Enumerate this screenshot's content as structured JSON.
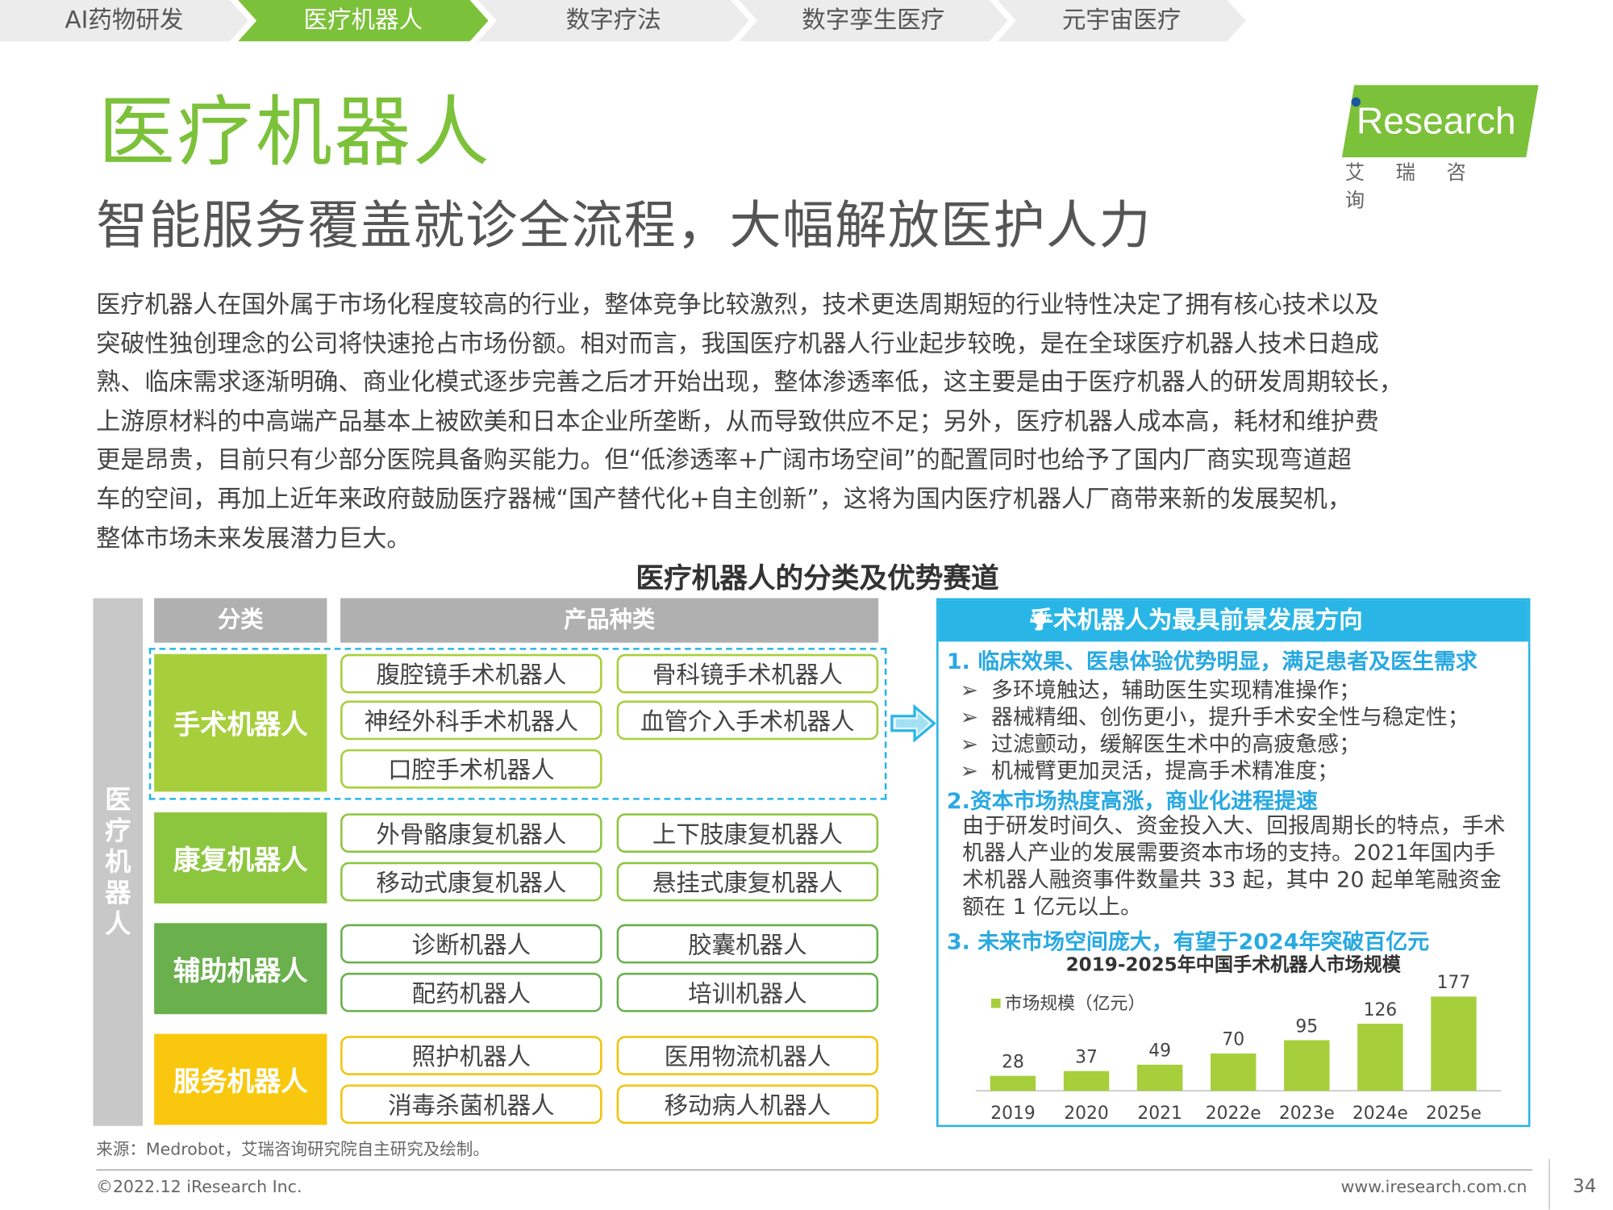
{
  "tabs": [
    {
      "label": "AI药物研发",
      "active": false
    },
    {
      "label": "医疗机器人",
      "active": true
    },
    {
      "label": "数字疗法",
      "active": false
    },
    {
      "label": "数字孪生医疗",
      "active": false
    },
    {
      "label": "元宇宙医疗",
      "active": false
    }
  ],
  "header": {
    "title": "医疗机器人",
    "subtitle": "智能服务覆盖就诊全流程，大幅解放医护人力"
  },
  "logo": {
    "text": "Research",
    "cn": "艾瑞咨询"
  },
  "body_text": "医疗机器人在国外属于市场化程度较高的行业，整体竞争比较激烈，技术更迭周期短的行业特性决定了拥有核心技术以及\n突破性独创理念的公司将快速抢占市场份额。相对而言，我国医疗机器人行业起步较晚，是在全球医疗机器人技术日趋成\n熟、临床需求逐渐明确、商业化模式逐步完善之后才开始出现，整体渗透率低，这主要是由于医疗机器人的研发周期较长，\n上游原材料的中高端产品基本上被欧美和日本企业所垄断，从而导致供应不足；另外，医疗机器人成本高，耗材和维护费\n更是昂贵，目前只有少部分医院具备购买能力。但“低渗透率+广阔市场空间”的配置同时也给予了国内厂商实现弯道超\n车的空间，再加上近年来政府鼓励医疗器械“国产替代化+自主创新”，这将为国内医疗机器人厂商带来新的发展契机，\n整体市场未来发展潜力巨大。",
  "figure_title": "医疗机器人的分类及优势赛道",
  "table": {
    "side_label": "医疗机器人",
    "header_category": "分类",
    "header_products": "产品种类",
    "categories": [
      {
        "name": "手术机器人",
        "color": "#a6cf3b",
        "products": [
          "腹腔镜手术机器人",
          "骨科镜手术机器人",
          "神经外科手术机器人",
          "血管介入手术机器人",
          "口腔手术机器人"
        ]
      },
      {
        "name": "康复机器人",
        "color": "#8cc63f",
        "products": [
          "外骨骼康复机器人",
          "上下肢康复机器人",
          "移动式康复机器人",
          "悬挂式康复机器人"
        ]
      },
      {
        "name": "辅助机器人",
        "color": "#6ab04c",
        "products": [
          "诊断机器人",
          "胶囊机器人",
          "配药机器人",
          "培训机器人"
        ]
      },
      {
        "name": "服务机器人",
        "color": "#f9c80e",
        "products": [
          "照护机器人",
          "医用物流机器人",
          "消毒杀菌机器人",
          "移动病人机器人"
        ]
      }
    ]
  },
  "panel": {
    "header": "手术机器人为最具前景发展方向",
    "sec1": "1.  临床效果、医患体验优势明显，满足患者及医生需求",
    "bullets": [
      "多环境触达，辅助医生实现精准操作；",
      "器械精细、创伤更小，提升手术安全性与稳定性；",
      "过滤颤动，缓解医生术中的高疲惫感；",
      "机械臂更加灵活，提高手术精准度；"
    ],
    "sec2": "2.资本市场热度高涨，商业化进程提速",
    "para2": "由于研发时间久、资金投入大、回报周期长的特点，手术机器人产业的发展需要资本市场的支持。2021年国内手术机器人融资事件数量共 33 起，其中 20 起单笔融资金额在 1 亿元以上。",
    "sec3": "3. 未来市场空间庞大，有望于2024年突破百亿元"
  },
  "chart_data": {
    "type": "bar",
    "title": "2019-2025年中国手术机器人市场规模",
    "categories": [
      "2019",
      "2020",
      "2021",
      "2022e",
      "2023e",
      "2024e",
      "2025e"
    ],
    "series": [
      {
        "name": "市场规模（亿元）",
        "values": [
          28,
          37,
          49,
          70,
          95,
          126,
          177
        ],
        "color": "#a6cf3b"
      }
    ],
    "legend_position": "top-left",
    "grid": false
  },
  "footer": {
    "source": "来源：Medrobot，艾瑞咨询研究院自主研究及绘制。",
    "copyright": "©2022.12 iResearch Inc.",
    "site": "www.iresearch.com.cn",
    "page": "34"
  }
}
